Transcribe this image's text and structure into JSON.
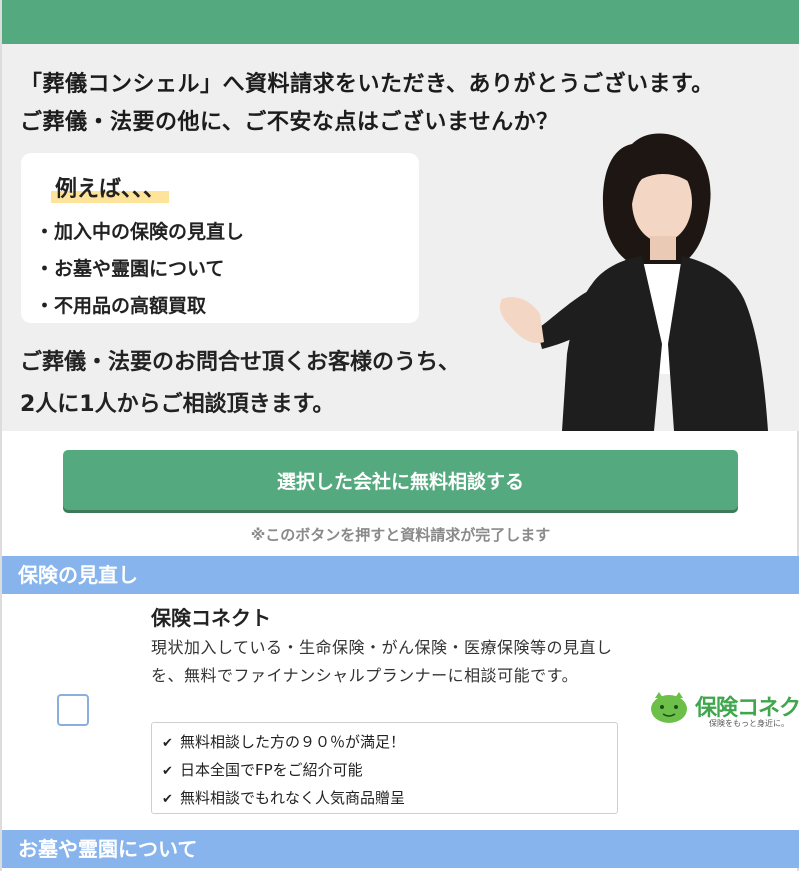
{
  "hero": {
    "line1": "「葬儀コンシェル」へ資料請求をいただき、ありがとうございます。",
    "line2": "ご葬儀・法要の他に、ご不安な点はございませんか？",
    "example_title": "例えば、、、",
    "examples": [
      "・加入中の保険の見直し",
      "・お墓や霊園について",
      "・不用品の高額買取"
    ],
    "bottom1": "ご葬儀・法要のお問合せ頂くお客様のうち、",
    "bottom2": "2人に1人からご相談頂きます。"
  },
  "cta": {
    "button_label": "選択した会社に無料相談する",
    "note": "※このボタンを押すと資料請求が完了します"
  },
  "sections": [
    {
      "title": "保険の見直し",
      "company": {
        "name": "保険コネクト",
        "description": "現状加入している・生命保険・がん保険・医療保険等の見直しを、無料でファイナンシャルプランナーに相談可能です。",
        "features": [
          "無料相談した方の９０％が満足！",
          "日本全国でFPをご紹介可能",
          "無料相談でもれなく人気商品贈呈"
        ],
        "logo_text": "保険コネクト",
        "logo_sub": "保険をもっと身近に。",
        "checked": false
      }
    },
    {
      "title": "お墓や霊園について"
    }
  ],
  "colors": {
    "brand_green": "#54a97e",
    "section_blue": "#87b4ec",
    "highlight_yellow": "#fde49a",
    "logo_green": "#3fa64c"
  }
}
